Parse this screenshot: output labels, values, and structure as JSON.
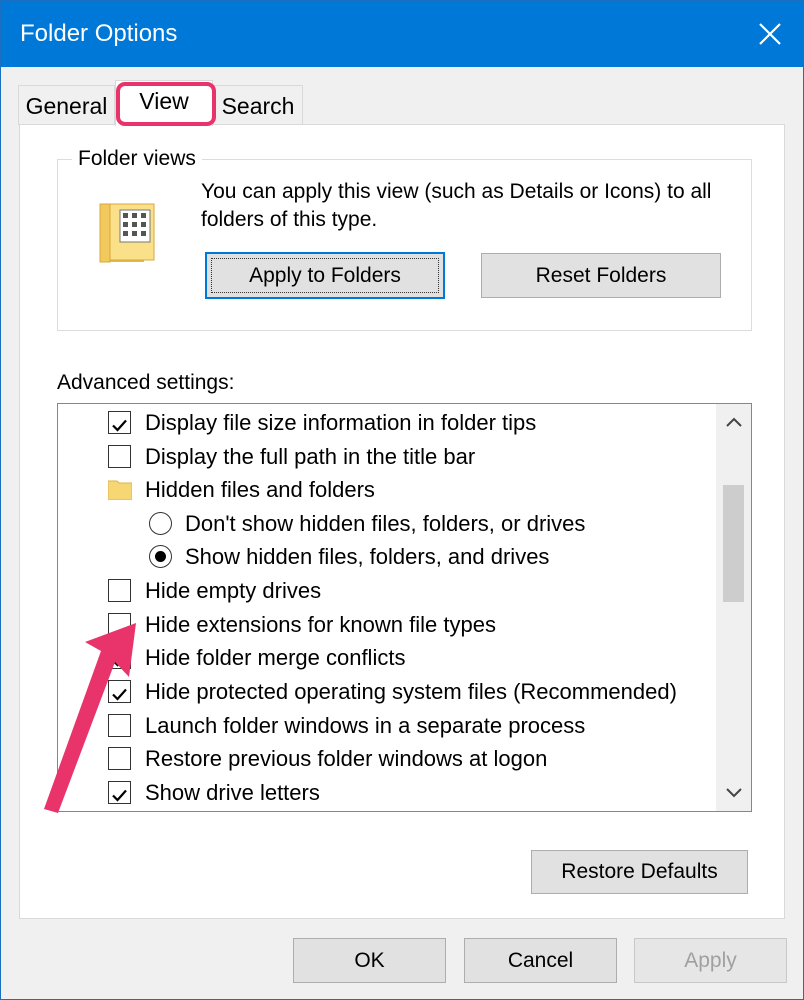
{
  "window": {
    "title": "Folder Options"
  },
  "tabs": [
    {
      "label": "General"
    },
    {
      "label": "View"
    },
    {
      "label": "Search"
    }
  ],
  "folder_views": {
    "label": "Folder views",
    "description": "You can apply this view (such as Details or Icons) to all folders of this type.",
    "apply_button": "Apply to Folders",
    "reset_button": "Reset Folders"
  },
  "advanced": {
    "label": "Advanced settings:",
    "items": [
      {
        "type": "checkbox",
        "checked": true,
        "label": "Display file size information in folder tips"
      },
      {
        "type": "checkbox",
        "checked": false,
        "label": "Display the full path in the title bar"
      },
      {
        "type": "folder",
        "label": "Hidden files and folders"
      },
      {
        "type": "radio",
        "checked": false,
        "label": "Don't show hidden files, folders, or drives"
      },
      {
        "type": "radio",
        "checked": true,
        "label": "Show hidden files, folders, and drives"
      },
      {
        "type": "checkbox",
        "checked": false,
        "label": "Hide empty drives"
      },
      {
        "type": "checkbox",
        "checked": false,
        "label": "Hide extensions for known file types"
      },
      {
        "type": "checkbox",
        "checked": true,
        "label": "Hide folder merge conflicts"
      },
      {
        "type": "checkbox",
        "checked": true,
        "label": "Hide protected operating system files (Recommended)"
      },
      {
        "type": "checkbox",
        "checked": false,
        "label": "Launch folder windows in a separate process"
      },
      {
        "type": "checkbox",
        "checked": false,
        "label": "Restore previous folder windows at logon"
      },
      {
        "type": "checkbox",
        "checked": true,
        "label": "Show drive letters"
      }
    ]
  },
  "restore_defaults": "Restore Defaults",
  "footer": {
    "ok": "OK",
    "cancel": "Cancel",
    "apply": "Apply"
  },
  "colors": {
    "titlebar": "#0078d7",
    "highlight": "#e8336b",
    "accent_focus": "#0078d7",
    "disabled_text": "#a0a0a0"
  },
  "icons": [
    "close-icon",
    "folder-views-icon",
    "folder-icon",
    "check-icon",
    "scroll-up-icon",
    "scroll-down-icon"
  ]
}
